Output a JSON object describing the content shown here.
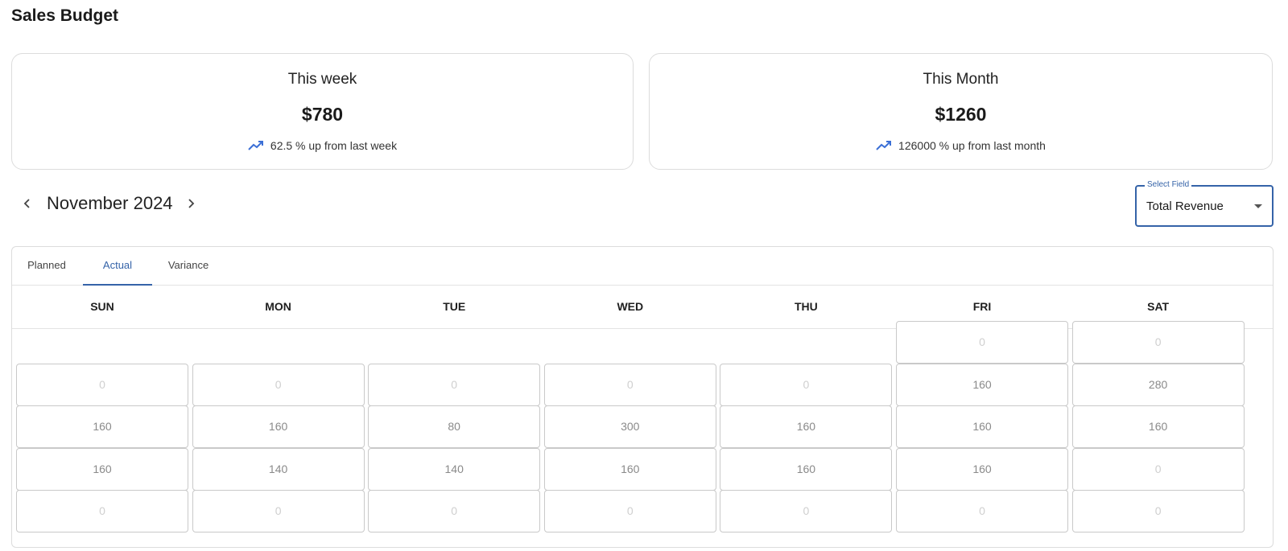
{
  "page": {
    "title": "Sales Budget"
  },
  "cards": {
    "week": {
      "label": "This week",
      "value": "$780",
      "trend": "62.5 % up from last week",
      "trend_icon": "trending-up-icon"
    },
    "month": {
      "label": "This Month",
      "value": "$1260",
      "trend": "126000 % up from last month",
      "trend_icon": "trending-up-icon"
    }
  },
  "calendar": {
    "month_label": "November 2024",
    "prev_icon": "chevron-left-icon",
    "next_icon": "chevron-right-icon",
    "tabs": [
      "Planned",
      "Actual",
      "Variance"
    ],
    "active_tab": "Actual",
    "days": [
      "SUN",
      "MON",
      "TUE",
      "WED",
      "THU",
      "FRI",
      "SAT"
    ],
    "weeks": [
      [
        null,
        null,
        null,
        null,
        null,
        "0",
        "0"
      ],
      [
        "0",
        "0",
        "0",
        "0",
        "0",
        "160",
        "280"
      ],
      [
        "160",
        "160",
        "80",
        "300",
        "160",
        "160",
        "160"
      ],
      [
        "160",
        "140",
        "140",
        "160",
        "160",
        "160",
        "0"
      ],
      [
        "0",
        "0",
        "0",
        "0",
        "0",
        "0",
        "0"
      ]
    ]
  },
  "select_field": {
    "label": "Select Field",
    "value": "Total Revenue"
  },
  "colors": {
    "accent": "#3563a8",
    "trend_icon": "#3b6fd6",
    "border": "#dcdcdc"
  }
}
